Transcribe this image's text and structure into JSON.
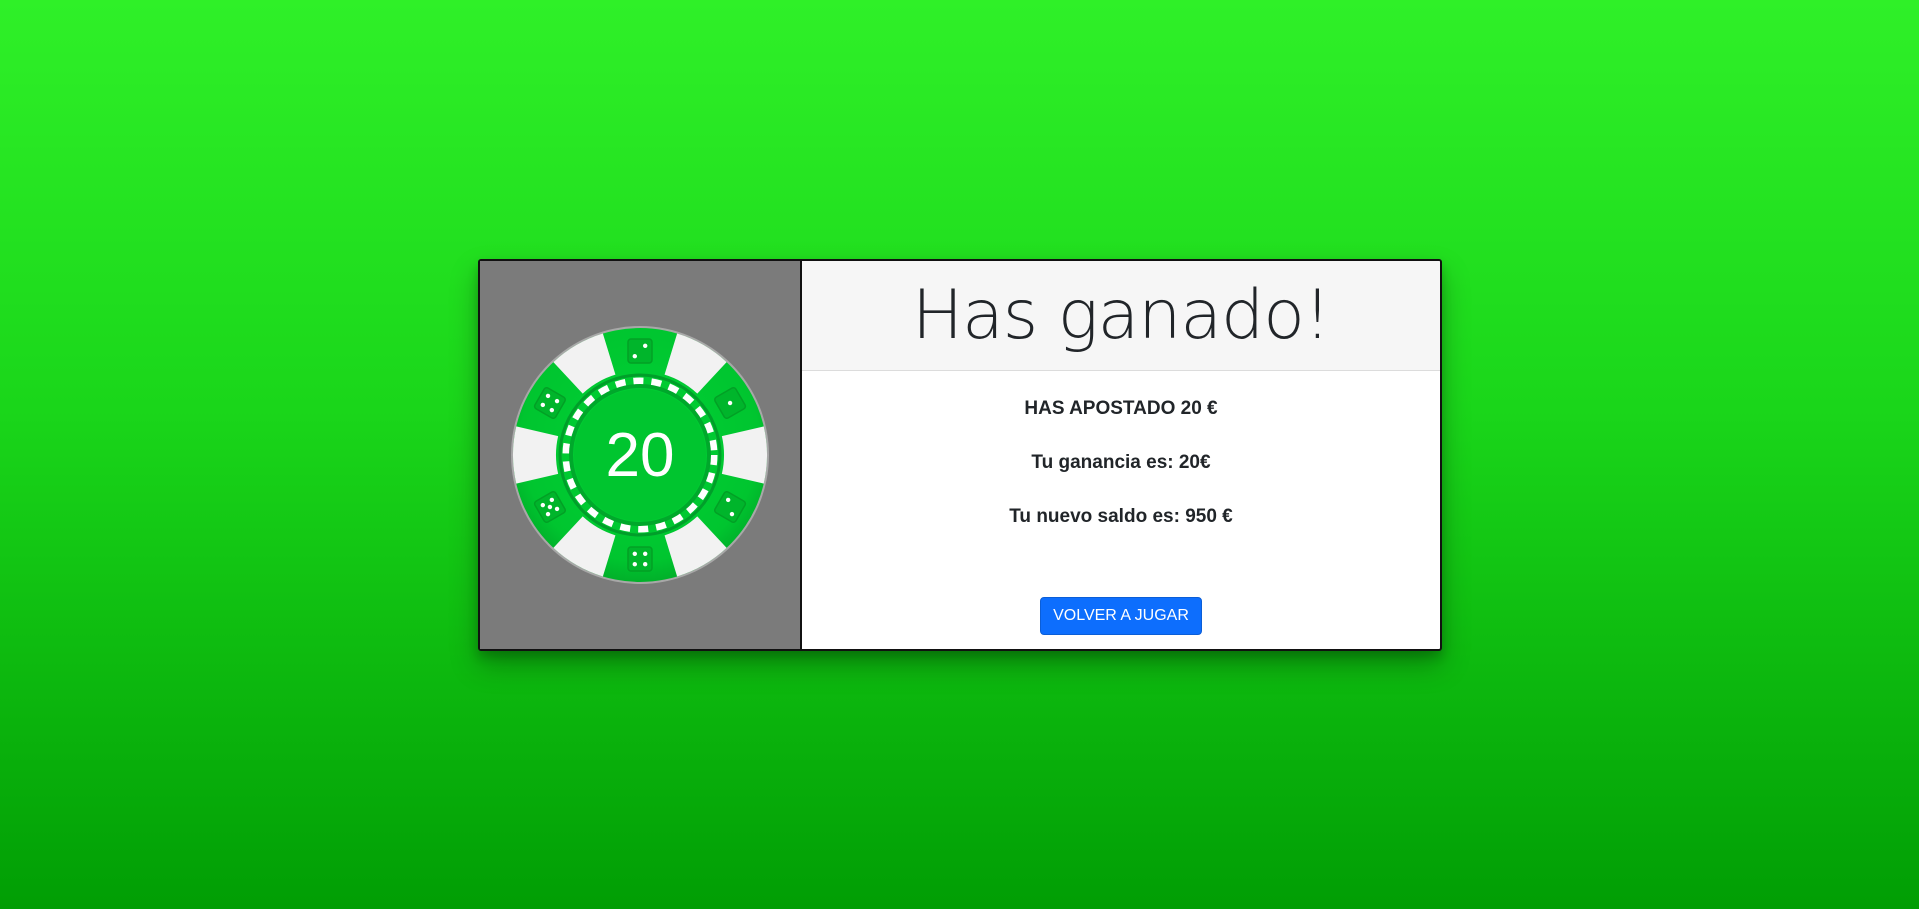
{
  "chip": {
    "value": "20",
    "color": "#00c52f",
    "dice": [
      "dice-2",
      "dice-1",
      "dice-2",
      "dice-4",
      "dice-5",
      "dice-4"
    ]
  },
  "result": {
    "title": "Has ganado!",
    "bet_text": "HAS APOSTADO 20 €",
    "winnings_text": "Tu ganancia es: 20€",
    "balance_text": "Tu nuevo saldo es: 950 €"
  },
  "actions": {
    "play_again_label": "VOLVER A JUGAR",
    "button_color": "#0d6efd"
  },
  "theme": {
    "background_top": "#2ff028",
    "background_bottom": "#019e04",
    "panel_gray": "#7b7b7b"
  }
}
